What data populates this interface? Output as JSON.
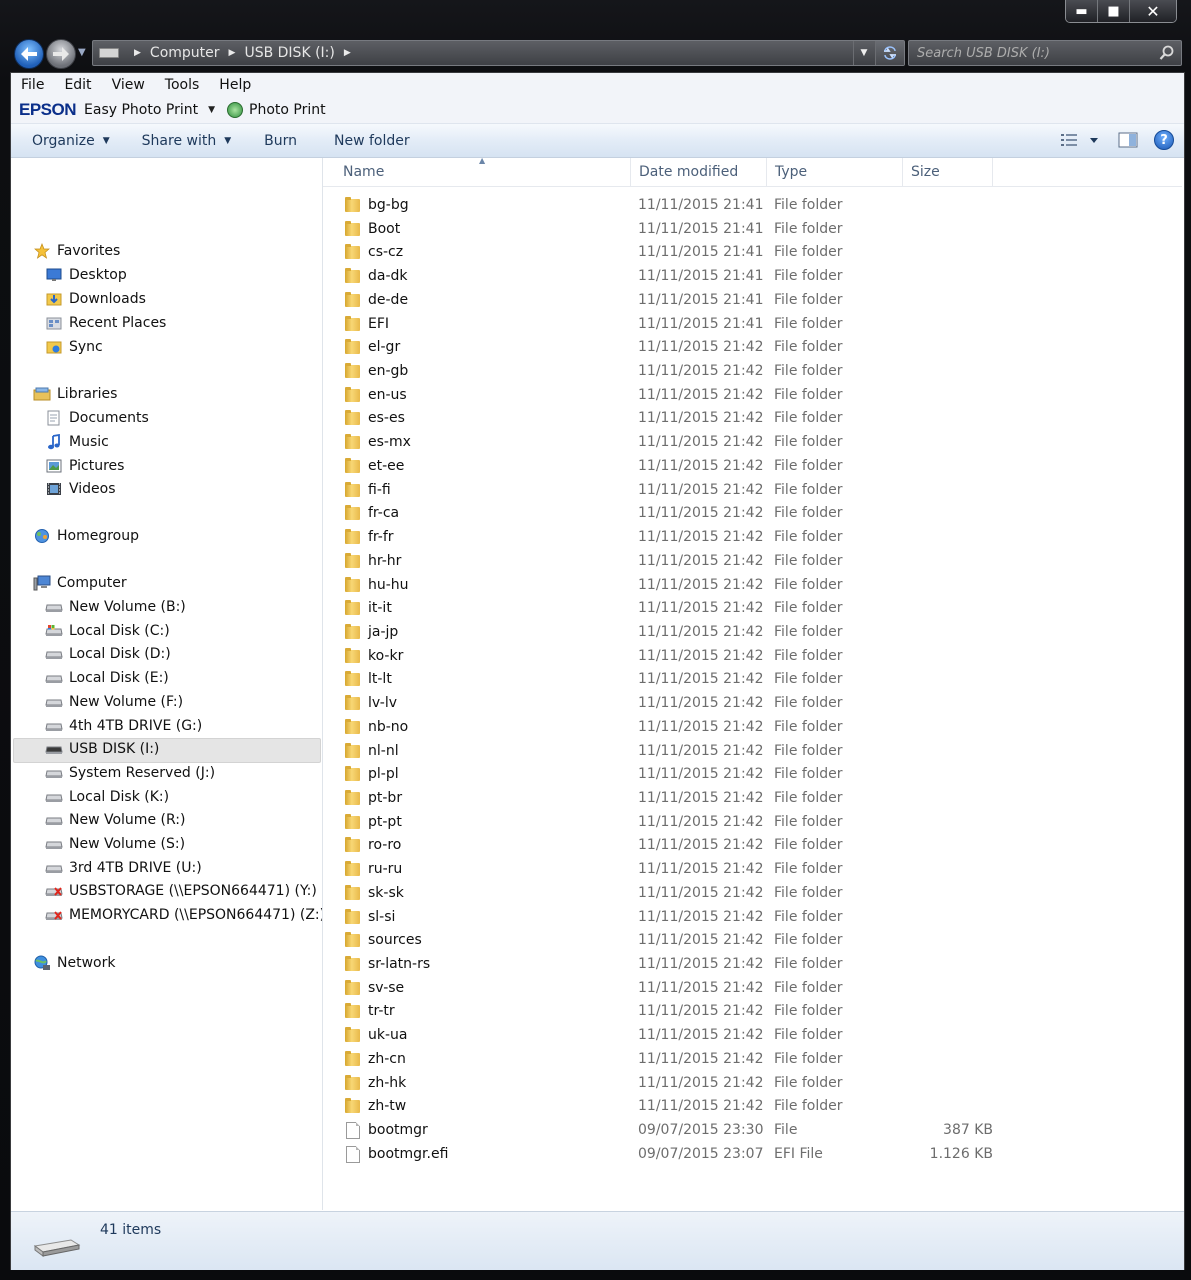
{
  "caption": {
    "minimize": "▬",
    "maximize": "■",
    "close": "✕"
  },
  "address": {
    "crumbs": [
      "Computer",
      "USB DISK (I:)"
    ]
  },
  "search": {
    "placeholder": "Search USB DISK (I:)"
  },
  "menu": [
    "File",
    "Edit",
    "View",
    "Tools",
    "Help"
  ],
  "epson": {
    "logo": "EPSON",
    "easy_photo_print": "Easy Photo Print",
    "photo_print": "Photo Print"
  },
  "toolbar": {
    "organize": "Organize",
    "share_with": "Share with",
    "burn": "Burn",
    "new_folder": "New folder"
  },
  "nav": {
    "favorites": {
      "label": "Favorites",
      "items": [
        "Desktop",
        "Downloads",
        "Recent Places",
        "Sync"
      ]
    },
    "libraries": {
      "label": "Libraries",
      "items": [
        "Documents",
        "Music",
        "Pictures",
        "Videos"
      ]
    },
    "homegroup": "Homegroup",
    "computer": {
      "label": "Computer",
      "items": [
        "New Volume (B:)",
        "Local Disk (C:)",
        "Local Disk (D:)",
        "Local Disk (E:)",
        "New Volume (F:)",
        "4th 4TB DRIVE (G:)",
        "USB DISK (I:)",
        "System Reserved (J:)",
        "Local Disk (K:)",
        "New Volume (R:)",
        "New Volume (S:)",
        "3rd 4TB DRIVE (U:)",
        "USBSTORAGE (\\\\EPSON664471) (Y:)",
        "MEMORYCARD (\\\\EPSON664471) (Z:)"
      ]
    },
    "network": "Network",
    "selected": "USB DISK (I:)"
  },
  "columns": {
    "name": "Name",
    "date": "Date modified",
    "type": "Type",
    "size": "Size"
  },
  "files": [
    {
      "name": "bg-bg",
      "date": "11/11/2015 21:41",
      "type": "File folder",
      "size": ""
    },
    {
      "name": "Boot",
      "date": "11/11/2015 21:41",
      "type": "File folder",
      "size": ""
    },
    {
      "name": "cs-cz",
      "date": "11/11/2015 21:41",
      "type": "File folder",
      "size": ""
    },
    {
      "name": "da-dk",
      "date": "11/11/2015 21:41",
      "type": "File folder",
      "size": ""
    },
    {
      "name": "de-de",
      "date": "11/11/2015 21:41",
      "type": "File folder",
      "size": ""
    },
    {
      "name": "EFI",
      "date": "11/11/2015 21:41",
      "type": "File folder",
      "size": ""
    },
    {
      "name": "el-gr",
      "date": "11/11/2015 21:42",
      "type": "File folder",
      "size": ""
    },
    {
      "name": "en-gb",
      "date": "11/11/2015 21:42",
      "type": "File folder",
      "size": ""
    },
    {
      "name": "en-us",
      "date": "11/11/2015 21:42",
      "type": "File folder",
      "size": ""
    },
    {
      "name": "es-es",
      "date": "11/11/2015 21:42",
      "type": "File folder",
      "size": ""
    },
    {
      "name": "es-mx",
      "date": "11/11/2015 21:42",
      "type": "File folder",
      "size": ""
    },
    {
      "name": "et-ee",
      "date": "11/11/2015 21:42",
      "type": "File folder",
      "size": ""
    },
    {
      "name": "fi-fi",
      "date": "11/11/2015 21:42",
      "type": "File folder",
      "size": ""
    },
    {
      "name": "fr-ca",
      "date": "11/11/2015 21:42",
      "type": "File folder",
      "size": ""
    },
    {
      "name": "fr-fr",
      "date": "11/11/2015 21:42",
      "type": "File folder",
      "size": ""
    },
    {
      "name": "hr-hr",
      "date": "11/11/2015 21:42",
      "type": "File folder",
      "size": ""
    },
    {
      "name": "hu-hu",
      "date": "11/11/2015 21:42",
      "type": "File folder",
      "size": ""
    },
    {
      "name": "it-it",
      "date": "11/11/2015 21:42",
      "type": "File folder",
      "size": ""
    },
    {
      "name": "ja-jp",
      "date": "11/11/2015 21:42",
      "type": "File folder",
      "size": ""
    },
    {
      "name": "ko-kr",
      "date": "11/11/2015 21:42",
      "type": "File folder",
      "size": ""
    },
    {
      "name": "lt-lt",
      "date": "11/11/2015 21:42",
      "type": "File folder",
      "size": ""
    },
    {
      "name": "lv-lv",
      "date": "11/11/2015 21:42",
      "type": "File folder",
      "size": ""
    },
    {
      "name": "nb-no",
      "date": "11/11/2015 21:42",
      "type": "File folder",
      "size": ""
    },
    {
      "name": "nl-nl",
      "date": "11/11/2015 21:42",
      "type": "File folder",
      "size": ""
    },
    {
      "name": "pl-pl",
      "date": "11/11/2015 21:42",
      "type": "File folder",
      "size": ""
    },
    {
      "name": "pt-br",
      "date": "11/11/2015 21:42",
      "type": "File folder",
      "size": ""
    },
    {
      "name": "pt-pt",
      "date": "11/11/2015 21:42",
      "type": "File folder",
      "size": ""
    },
    {
      "name": "ro-ro",
      "date": "11/11/2015 21:42",
      "type": "File folder",
      "size": ""
    },
    {
      "name": "ru-ru",
      "date": "11/11/2015 21:42",
      "type": "File folder",
      "size": ""
    },
    {
      "name": "sk-sk",
      "date": "11/11/2015 21:42",
      "type": "File folder",
      "size": ""
    },
    {
      "name": "sl-si",
      "date": "11/11/2015 21:42",
      "type": "File folder",
      "size": ""
    },
    {
      "name": "sources",
      "date": "11/11/2015 21:42",
      "type": "File folder",
      "size": ""
    },
    {
      "name": "sr-latn-rs",
      "date": "11/11/2015 21:42",
      "type": "File folder",
      "size": ""
    },
    {
      "name": "sv-se",
      "date": "11/11/2015 21:42",
      "type": "File folder",
      "size": ""
    },
    {
      "name": "tr-tr",
      "date": "11/11/2015 21:42",
      "type": "File folder",
      "size": ""
    },
    {
      "name": "uk-ua",
      "date": "11/11/2015 21:42",
      "type": "File folder",
      "size": ""
    },
    {
      "name": "zh-cn",
      "date": "11/11/2015 21:42",
      "type": "File folder",
      "size": ""
    },
    {
      "name": "zh-hk",
      "date": "11/11/2015 21:42",
      "type": "File folder",
      "size": ""
    },
    {
      "name": "zh-tw",
      "date": "11/11/2015 21:42",
      "type": "File folder",
      "size": ""
    },
    {
      "name": "bootmgr",
      "date": "09/07/2015 23:30",
      "type": "File",
      "size": "387 KB"
    },
    {
      "name": "bootmgr.efi",
      "date": "09/07/2015 23:07",
      "type": "EFI File",
      "size": "1.126 KB"
    }
  ],
  "status": {
    "items_text": "41 items"
  },
  "colors": {
    "accent": "#1e395b",
    "folder": "#f2c94c",
    "selection": "#e5e5e5"
  }
}
